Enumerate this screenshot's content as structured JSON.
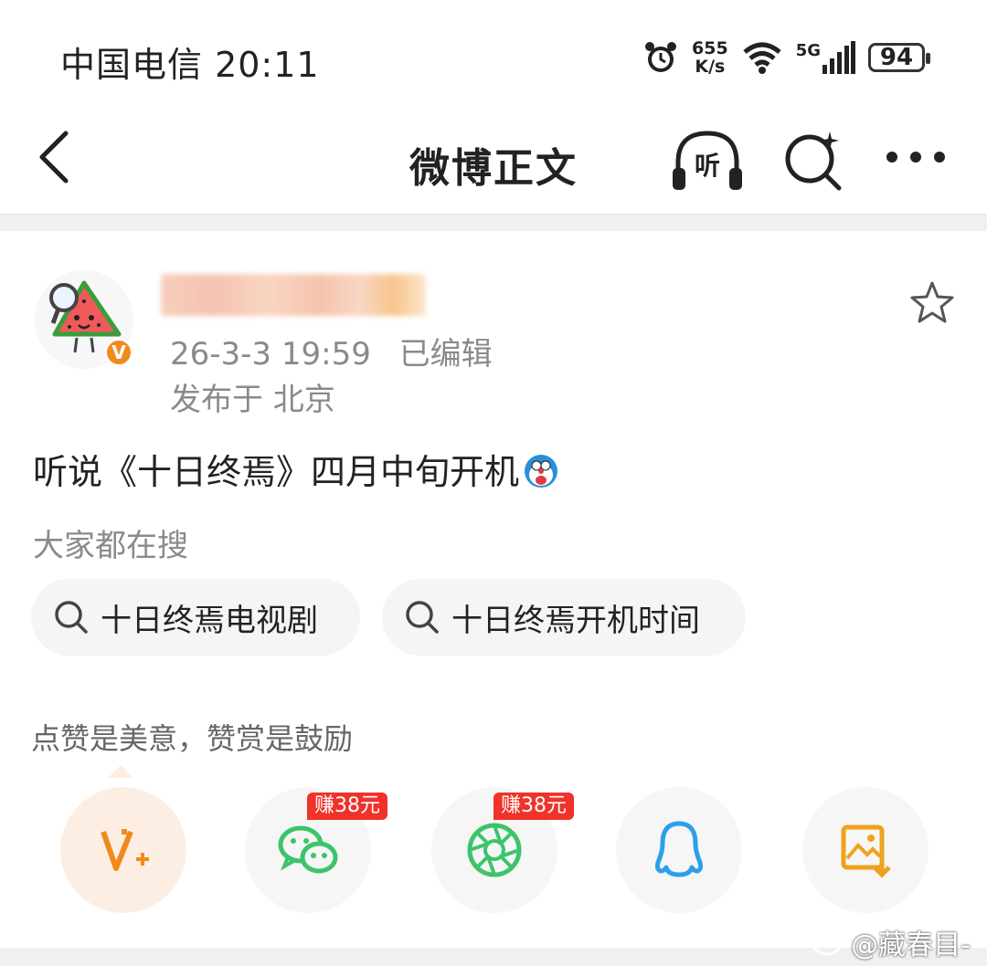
{
  "status_bar": {
    "carrier_time": "中国电信 20:11",
    "net_speed_value": "655",
    "net_speed_unit": "K/s",
    "network": "5G",
    "battery": "94"
  },
  "nav": {
    "title": "微博正文",
    "listen_label": "听"
  },
  "post": {
    "timestamp": "26-3-3 19:59",
    "edited": "已编辑",
    "location": "发布于 北京",
    "verified_mark": "V",
    "text": "听说《十日终焉》四月中旬开机"
  },
  "search": {
    "hint": "大家都在搜",
    "chips": [
      "十日终焉电视剧",
      "十日终焉开机时间"
    ]
  },
  "reward": {
    "hint": "点赞是美意，赞赏是鼓励",
    "badges": [
      "赚38元",
      "赚38元"
    ]
  },
  "watermark": "@藏春目-",
  "colors": {
    "accent_orange": "#f08a1c",
    "wechat_green": "#3cc46a",
    "qq_blue": "#2aa0e8",
    "badge_red": "#f0322a"
  },
  "icons": [
    "back-icon",
    "listen-icon",
    "search-icon",
    "more-icon",
    "star-icon",
    "vplus-icon",
    "wechat-icon",
    "moments-icon",
    "qq-icon",
    "save-image-icon"
  ]
}
